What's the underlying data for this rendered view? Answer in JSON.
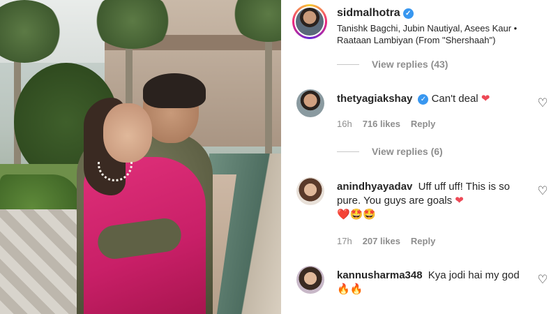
{
  "post": {
    "username": "sidmalhotra",
    "verified_icon": "verified-badge-icon",
    "song": "Tanishk Bagchi, Jubin Nautiyal, Asees Kaur • Raataan Lambiyan (From \"Shershaah\")"
  },
  "view_replies": [
    {
      "label": "View replies (43)"
    },
    {
      "label": "View replies (6)"
    }
  ],
  "comments": [
    {
      "username": "thetyagiakshay",
      "verified": true,
      "text": "Can't deal",
      "emoji": "❤",
      "time": "16h",
      "likes": "716 likes",
      "reply": "Reply"
    },
    {
      "username": "anindhyayadav",
      "verified": false,
      "text": "Uff uff uff! This is so pure. You guys are goals",
      "emoji": "❤",
      "emoji_line": "❤️🤩🤩",
      "time": "17h",
      "likes": "207 likes",
      "reply": "Reply"
    },
    {
      "username": "kannusharma348",
      "verified": false,
      "text": "Kya jodi hai my god",
      "emoji": "🔥🔥",
      "time": "",
      "likes": "",
      "reply": ""
    }
  ],
  "icons": {
    "like": "heart-outline-icon",
    "verified": "verified-badge-icon"
  },
  "colors": {
    "verified_blue": "#3897f0",
    "heart_red": "#ed4956",
    "meta_gray": "#8e8e8e"
  }
}
